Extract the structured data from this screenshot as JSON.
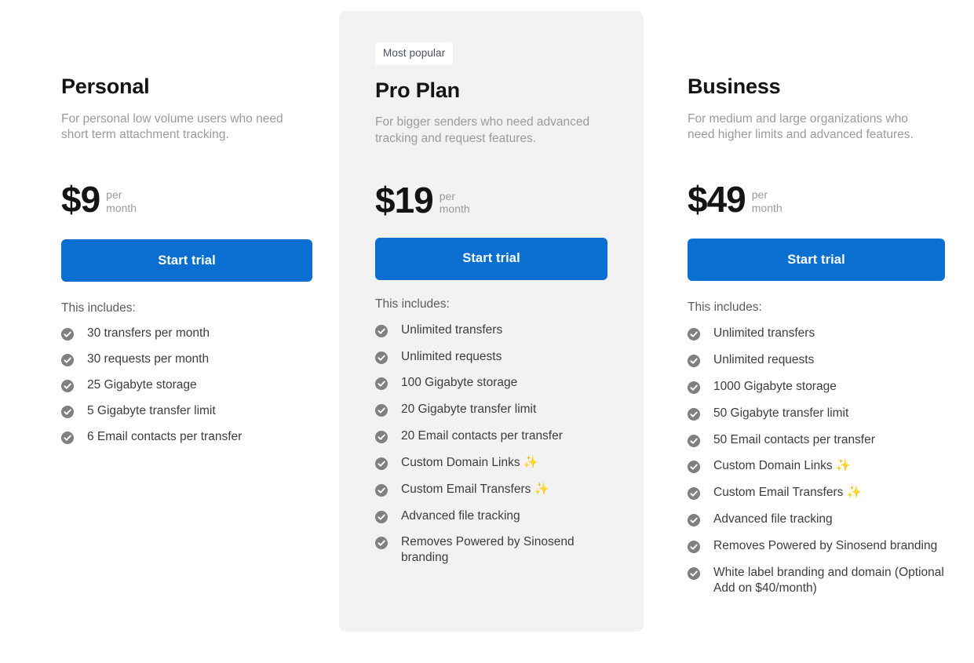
{
  "theme": {
    "page_background": "#ffffff",
    "accent_button": "#0a6fd0",
    "highlight_card_background": "#f2f2f2",
    "check_icon_color": "#808080",
    "sparkle_color": "#f5b324",
    "muted_text": "#9b9b9b"
  },
  "plans": [
    {
      "id": "personal",
      "name": "Personal",
      "description": "For personal low volume users who need short term attachment tracking.",
      "price": "$9",
      "period_line1": "per",
      "period_line2": "month",
      "cta_label": "Start trial",
      "includes_label": "This includes:",
      "features": [
        "30 transfers per month",
        "30 requests per month",
        "25 Gigabyte storage",
        "5 Gigabyte transfer limit",
        "6 Email contacts per transfer"
      ]
    },
    {
      "id": "pro",
      "badge": "Most popular",
      "name": "Pro Plan",
      "description": "For bigger senders who need advanced tracking and request features.",
      "price": "$19",
      "period_line1": "per",
      "period_line2": "month",
      "cta_label": "Start trial",
      "includes_label": "This includes:",
      "features": [
        "Unlimited transfers",
        "Unlimited requests",
        "100 Gigabyte storage",
        "20 Gigabyte transfer limit",
        "20 Email contacts per transfer",
        "Custom Domain Links ✨",
        "Custom Email Transfers ✨",
        "Advanced file tracking",
        "Removes Powered by Sinosend branding"
      ]
    },
    {
      "id": "business",
      "name": "Business",
      "description": "For medium and large organizations who need higher limits and advanced features.",
      "price": "$49",
      "period_line1": "per",
      "period_line2": "month",
      "cta_label": "Start trial",
      "includes_label": "This includes:",
      "features": [
        "Unlimited transfers",
        "Unlimited requests",
        "1000 Gigabyte storage",
        "50 Gigabyte transfer limit",
        "50 Email contacts per transfer",
        "Custom Domain Links ✨",
        "Custom Email Transfers ✨",
        "Advanced file tracking",
        "Removes Powered by Sinosend branding",
        "White label branding and domain (Optional Add on $40/month)"
      ]
    }
  ]
}
